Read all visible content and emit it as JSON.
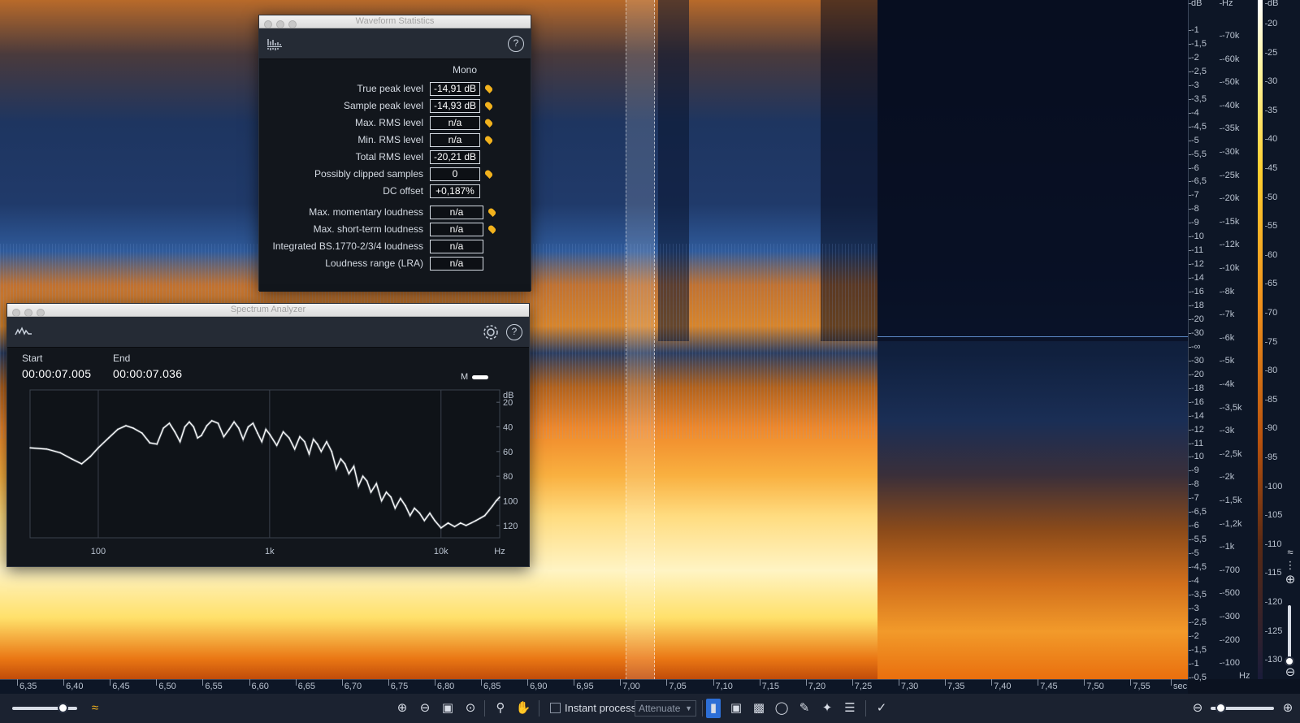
{
  "colors": {
    "accent": "#2d6fd6",
    "peak_marker": "#f2b21d",
    "spectrum_line": "#ffffff",
    "panel_bg": "#12161c"
  },
  "waveform_statistics": {
    "title": "Waveform Statistics",
    "header_icon": "waveform-stats-icon",
    "channel": "Mono",
    "rows": [
      {
        "label": "True peak level",
        "value": "-14,91 dB",
        "marker": true
      },
      {
        "label": "Sample peak level",
        "value": "-14,93 dB",
        "marker": true
      },
      {
        "label": "Max. RMS level",
        "value": "n/a",
        "marker": true
      },
      {
        "label": "Min. RMS level",
        "value": "n/a",
        "marker": true
      },
      {
        "label": "Total RMS level",
        "value": "-20,21 dB",
        "marker": false
      },
      {
        "label": "Possibly clipped samples",
        "value": "0",
        "marker": true
      },
      {
        "label": "DC offset",
        "value": "+0,187%",
        "marker": false
      },
      {
        "label": "Max. momentary loudness",
        "value": "n/a",
        "marker": true
      },
      {
        "label": "Max. short-term loudness",
        "value": "n/a",
        "marker": true
      },
      {
        "label": "Integrated BS.1770-2/3/4 loudness",
        "value": "n/a",
        "marker": false
      },
      {
        "label": "Loudness range (LRA)",
        "value": "n/a",
        "marker": false
      }
    ]
  },
  "spectrum_analyzer": {
    "title": "Spectrum Analyzer",
    "header_icon": "spectrum-icon",
    "start_label": "Start",
    "start_value": "00:00:07.005",
    "end_label": "End",
    "end_value": "00:00:07.036",
    "channel_toggle_label": "M",
    "db_unit": "dB",
    "hz_unit": "Hz",
    "db_ticks": [
      "20",
      "40",
      "60",
      "80",
      "100",
      "120"
    ],
    "freq_ticks": [
      "100",
      "1k",
      "10k"
    ]
  },
  "chart_data": {
    "type": "line",
    "title": "",
    "xlabel": "Hz",
    "ylabel": "dB",
    "x_scale": "log",
    "xlim": [
      40,
      22000
    ],
    "y_axis": "dB below reference (larger = lower on plot)",
    "ylim": [
      10,
      130
    ],
    "series": [
      {
        "x": [
          40,
          50,
          60,
          70,
          80,
          90,
          100,
          115,
          130,
          145,
          160,
          180,
          200,
          220,
          240,
          260,
          280,
          300,
          320,
          340,
          360,
          380,
          400,
          430,
          460,
          500,
          540,
          580,
          620,
          660,
          700,
          750,
          800,
          850,
          900,
          950,
          1000,
          1100,
          1200,
          1300,
          1400,
          1500,
          1600,
          1700,
          1800,
          1900,
          2000,
          2150,
          2300,
          2450,
          2600,
          2750,
          2900,
          3100,
          3300,
          3500,
          3700,
          3900,
          4200,
          4500,
          4800,
          5100,
          5400,
          5800,
          6200,
          6600,
          7000,
          7500,
          8000,
          8600,
          9200,
          10000,
          11000,
          12000,
          13000,
          14000,
          15000,
          16000,
          17000,
          18000,
          19000,
          20000,
          21000,
          22000
        ],
        "values": [
          57,
          58,
          61,
          66,
          70,
          64,
          57,
          49,
          42,
          39,
          41,
          45,
          53,
          54,
          41,
          37,
          44,
          52,
          40,
          36,
          40,
          49,
          47,
          39,
          35,
          37,
          48,
          42,
          36,
          41,
          50,
          40,
          37,
          45,
          52,
          42,
          46,
          55,
          44,
          49,
          58,
          48,
          52,
          62,
          50,
          54,
          60,
          52,
          60,
          74,
          66,
          70,
          78,
          72,
          88,
          80,
          84,
          93,
          86,
          100,
          93,
          97,
          106,
          98,
          104,
          112,
          106,
          110,
          116,
          110,
          116,
          122,
          118,
          121,
          118,
          120,
          118,
          116,
          114,
          112,
          108,
          104,
          100,
          97
        ]
      }
    ]
  },
  "db_scale": {
    "unit": "dB",
    "ticks": [
      "-1",
      "-1,5",
      "-2",
      "-2,5",
      "-3",
      "-3,5",
      "-4",
      "-4,5",
      "-5",
      "-5,5",
      "-6",
      "-6,5",
      "-7",
      "-8",
      "-9",
      "-10",
      "-11",
      "-12",
      "-14",
      "-16",
      "-18",
      "-20",
      "-30",
      "-∞",
      "-30",
      "-20",
      "-18",
      "-16",
      "-14",
      "-12",
      "-11",
      "-10",
      "-9",
      "-8",
      "-7",
      "-6,5",
      "-6",
      "-5,5",
      "-5",
      "-4,5",
      "-4",
      "-3,5",
      "-3",
      "-2,5",
      "-2",
      "-1,5",
      "-1",
      "-0,5"
    ]
  },
  "hz_scale": {
    "unit": "Hz",
    "ticks": [
      "-70k",
      "-60k",
      "-50k",
      "-40k",
      "-35k",
      "-30k",
      "-25k",
      "-20k",
      "-15k",
      "-12k",
      "-10k",
      "-8k",
      "-7k",
      "-6k",
      "-5k",
      "-4k",
      "-3,5k",
      "-3k",
      "-2,5k",
      "-2k",
      "-1,5k",
      "-1,2k",
      "-1k",
      "-700",
      "-500",
      "-300",
      "-200",
      "-100"
    ]
  },
  "colorbar_scale": {
    "unit": "dB",
    "ticks": [
      "20",
      "25",
      "30",
      "35",
      "40",
      "45",
      "50",
      "55",
      "60",
      "65",
      "70",
      "75",
      "80",
      "85",
      "90",
      "95",
      "100",
      "105",
      "110",
      "115",
      "120",
      "125",
      "130"
    ]
  },
  "time_ruler": {
    "unit": "sec",
    "ticks": [
      "6,35",
      "6,40",
      "6,45",
      "6,50",
      "6,55",
      "6,60",
      "6,65",
      "6,70",
      "6,75",
      "6,80",
      "6,85",
      "6,90",
      "6,95",
      "7,00",
      "7,05",
      "7,10",
      "7,15",
      "7,20",
      "7,25",
      "7,30",
      "7,35",
      "7,40",
      "7,45",
      "7,50",
      "7,55"
    ]
  },
  "toolbar": {
    "instant_process_label": "Instant process",
    "mode_value": "Attenuate",
    "horizontal_zoom": 0.78,
    "right_zoom": 0.15
  }
}
